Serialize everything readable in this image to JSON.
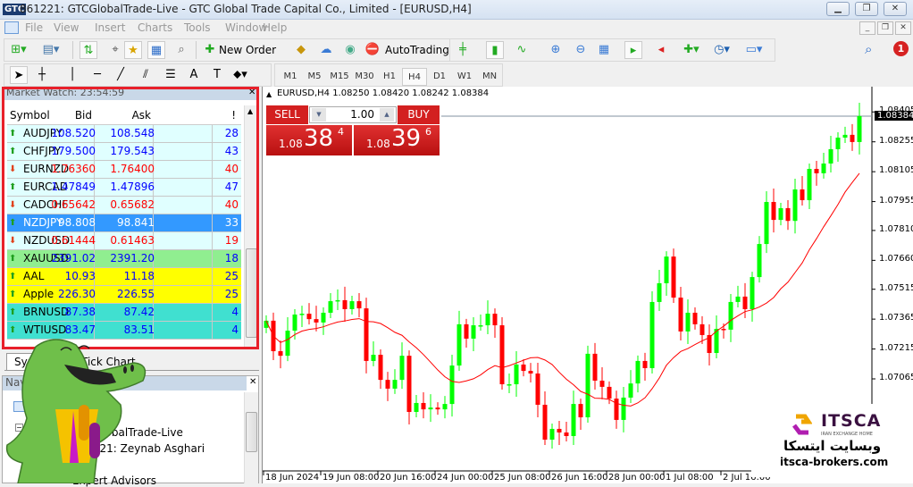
{
  "window": {
    "logo": "GTC",
    "title": "861221: GTCGlobalTrade-Live - GTC Global Trade Capital Co., Limited - [EURUSD,H4]",
    "buttons": [
      "minimize",
      "restore",
      "close"
    ]
  },
  "menu": {
    "items": [
      "File",
      "View",
      "Insert",
      "Charts",
      "Tools",
      "Window",
      "Help"
    ]
  },
  "toolbar": {
    "new_order": "New Order",
    "autotrading": "AutoTrading",
    "notification_count": "1"
  },
  "timeframes": {
    "items": [
      "M1",
      "M5",
      "M15",
      "M30",
      "H1",
      "H4",
      "D1",
      "W1",
      "MN"
    ],
    "selected": "H4"
  },
  "market_watch": {
    "title": "Market Watch: 23:54:59",
    "columns": [
      "Symbol",
      "Bid",
      "Ask",
      "!"
    ],
    "rows": [
      {
        "symbol": "AUDJPY",
        "bid": "108.520",
        "ask": "108.548",
        "spread": "28",
        "dir": "up",
        "bg": "#e0ffff",
        "fg": "#0000ff"
      },
      {
        "symbol": "CHFJPY",
        "bid": "179.500",
        "ask": "179.543",
        "spread": "43",
        "dir": "up",
        "bg": "#e0ffff",
        "fg": "#0000ff"
      },
      {
        "symbol": "EURNZD",
        "bid": "1.76360",
        "ask": "1.76400",
        "spread": "40",
        "dir": "down",
        "bg": "#e0ffff",
        "fg": "#ff0000"
      },
      {
        "symbol": "EURCAD",
        "bid": "1.47849",
        "ask": "1.47896",
        "spread": "47",
        "dir": "up",
        "bg": "#e0ffff",
        "fg": "#0000ff"
      },
      {
        "symbol": "CADCHF",
        "bid": "0.65642",
        "ask": "0.65682",
        "spread": "40",
        "dir": "down",
        "bg": "#e0ffff",
        "fg": "#ff0000"
      },
      {
        "symbol": "NZDJPY",
        "bid": "98.808",
        "ask": "98.841",
        "spread": "33",
        "dir": "up",
        "bg": "#3399ff",
        "fg": "#ffffff",
        "selected": true
      },
      {
        "symbol": "NZDUSD",
        "bid": "0.61444",
        "ask": "0.61463",
        "spread": "19",
        "dir": "down",
        "bg": "#e0ffff",
        "fg": "#ff0000"
      },
      {
        "symbol": "XAUUSD",
        "bid": "2391.02",
        "ask": "2391.20",
        "spread": "18",
        "dir": "up",
        "bg": "#90ee90",
        "fg": "#0000ff"
      },
      {
        "symbol": "AAL",
        "bid": "10.93",
        "ask": "11.18",
        "spread": "25",
        "dir": "up",
        "bg": "#ffff00",
        "fg": "#0000ff"
      },
      {
        "symbol": "Apple",
        "bid": "226.30",
        "ask": "226.55",
        "spread": "25",
        "dir": "up",
        "bg": "#ffff00",
        "fg": "#0000ff"
      },
      {
        "symbol": "BRNUSD",
        "bid": "87.38",
        "ask": "87.42",
        "spread": "4",
        "dir": "up",
        "bg": "#40e0d0",
        "fg": "#0000ff"
      },
      {
        "symbol": "WTIUSD",
        "bid": "83.47",
        "ask": "83.51",
        "spread": "4",
        "dir": "up",
        "bg": "#40e0d0",
        "fg": "#0000ff"
      }
    ],
    "tabs": [
      "Symbols",
      "Tick Chart"
    ]
  },
  "navigator": {
    "title": "Navigator",
    "items": [
      "GTCGlobalTrade-Live",
      "861221: Zeynab Asghari",
      "Expert Advisors"
    ]
  },
  "one_click": {
    "sell": "SELL",
    "buy": "BUY",
    "lot": "1.00",
    "sell_prefix": "1.08",
    "sell_big": "38",
    "sell_sup": "4",
    "buy_prefix": "1.08",
    "buy_big": "39",
    "buy_sup": "6",
    "color": "#d32020"
  },
  "watermark": {
    "brand": "ITSCA",
    "tagline": "IRAN EXCHANGE HOME",
    "persian": "وبسایت ایتسکا",
    "url": "itsca-brokers.com"
  },
  "chart_data": {
    "type": "candlestick",
    "header": "EURUSD,H4  1.08250 1.08420 1.08242 1.08384",
    "symbol": "EURUSD",
    "timeframe": "H4",
    "current_price": "1.08384",
    "up_color": "#00ff00",
    "down_color": "#ff0000",
    "ma_color": "#ff0000",
    "ylim": [
      1.069,
      1.0845
    ],
    "y_ticks": [
      "1.08405",
      "1.08255",
      "1.08105",
      "1.07955",
      "1.07810",
      "1.07660",
      "1.07515",
      "1.07365",
      "1.07215",
      "1.07065"
    ],
    "x_ticks": [
      "18 Jun 2024",
      "19 Jun 08:00",
      "20 Jun 16:00",
      "24 Jun 00:00",
      "25 Jun 08:00",
      "26 Jun 16:00",
      "28 Jun 00:00",
      "1 Jul 08:00",
      "2 Jul 16:00"
    ],
    "first_open": 1.07321,
    "closes": [
      1.07357,
      1.07204,
      1.07181,
      1.07307,
      1.07388,
      1.07392,
      1.07365,
      1.07348,
      1.07397,
      1.07455,
      1.0746,
      1.07415,
      1.07455,
      1.07419,
      1.07155,
      1.07186,
      1.0706,
      1.07016,
      1.0706,
      1.07181,
      1.06899,
      1.06944,
      1.06912,
      1.06921,
      1.06912,
      1.06939,
      1.07132,
      1.07339,
      1.07267,
      1.07334,
      1.07334,
      1.07392,
      1.07334,
      1.07038,
      1.07038,
      1.07137,
      1.07105,
      1.07092,
      1.06935,
      1.0676,
      1.06814,
      1.06796,
      1.06778,
      1.06939,
      1.06872,
      1.07191,
      1.07056,
      1.07025,
      1.06966,
      1.06859,
      1.06971,
      1.07042,
      1.07155,
      1.07119,
      1.07451,
      1.07545,
      1.07679,
      1.07473,
      1.07303,
      1.07397,
      1.07339,
      1.07285,
      1.07195,
      1.07316,
      1.07312,
      1.07451,
      1.07478,
      1.07415,
      1.07576,
      1.07742,
      1.07953,
      1.07863,
      1.07922,
      1.07858,
      1.08016,
      1.07962,
      1.08119,
      1.08097,
      1.08146,
      1.08218,
      1.08276,
      1.0829,
      1.08254,
      1.08384
    ]
  }
}
